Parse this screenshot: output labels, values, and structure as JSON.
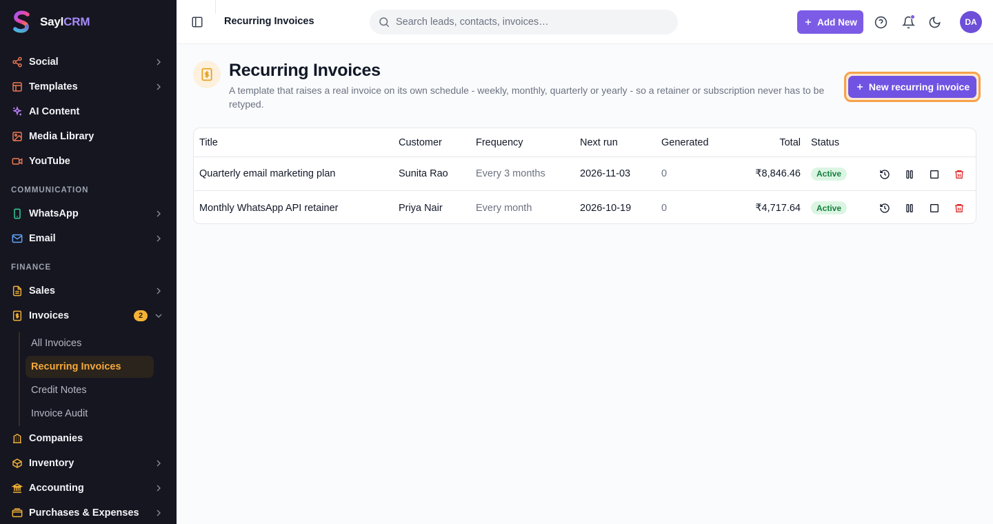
{
  "brand": {
    "name_prefix": "Sayl",
    "name_suffix": "CRM"
  },
  "sidebar": {
    "top_items": [
      {
        "label": "Social",
        "icon": "share-icon",
        "has_chevron": true
      },
      {
        "label": "Templates",
        "icon": "layout-icon",
        "has_chevron": true
      },
      {
        "label": "AI Content",
        "icon": "sparkles-icon",
        "has_chevron": false
      },
      {
        "label": "Media Library",
        "icon": "image-icon",
        "has_chevron": false
      },
      {
        "label": "YouTube",
        "icon": "video-icon",
        "has_chevron": false
      }
    ],
    "section_communication": "COMMUNICATION",
    "communication_items": [
      {
        "label": "WhatsApp",
        "icon": "phone-icon"
      },
      {
        "label": "Email",
        "icon": "mail-icon"
      }
    ],
    "section_finance": "FINANCE",
    "finance_items": [
      {
        "label": "Sales",
        "icon": "file-icon"
      },
      {
        "label": "Invoices",
        "icon": "invoice-icon",
        "badge": "2"
      }
    ],
    "invoice_sub_items": [
      {
        "label": "All Invoices",
        "active": false
      },
      {
        "label": "Recurring Invoices",
        "active": true
      },
      {
        "label": "Credit Notes",
        "active": false
      },
      {
        "label": "Invoice Audit",
        "active": false
      }
    ],
    "bottom_items": [
      {
        "label": "Companies",
        "icon": "building-icon",
        "has_chevron": false
      },
      {
        "label": "Inventory",
        "icon": "package-icon",
        "has_chevron": true
      },
      {
        "label": "Accounting",
        "icon": "landmark-icon",
        "has_chevron": true
      },
      {
        "label": "Purchases & Expenses",
        "icon": "wallet-icon",
        "has_chevron": true
      }
    ]
  },
  "topbar": {
    "breadcrumb": "Recurring Invoices",
    "search_placeholder": "Search leads, contacts, invoices…",
    "add_new_label": "Add New",
    "avatar_initials": "DA"
  },
  "page": {
    "title": "Recurring Invoices",
    "description": "A template that raises a real invoice on its own schedule - weekly, monthly, quarterly or yearly - so a retainer or subscription never has to be retyped.",
    "new_button_label": "New recurring invoice"
  },
  "table": {
    "columns": {
      "title": "Title",
      "customer": "Customer",
      "frequency": "Frequency",
      "next_run": "Next run",
      "generated": "Generated",
      "total": "Total",
      "status": "Status"
    },
    "rows": [
      {
        "title": "Quarterly email marketing plan",
        "customer": "Sunita Rao",
        "frequency": "Every 3 months",
        "next_run": "2026-11-03",
        "generated": "0",
        "total": "₹8,846.46",
        "status": "Active"
      },
      {
        "title": "Monthly WhatsApp API retainer",
        "customer": "Priya Nair",
        "frequency": "Every month",
        "next_run": "2026-10-19",
        "generated": "0",
        "total": "₹4,717.64",
        "status": "Active"
      }
    ]
  },
  "colors": {
    "sidebar_bg": "#161621",
    "accent_purple": "#7c5ce6",
    "accent_orange": "#f6a93b",
    "status_green": "#15803d",
    "danger_red": "#dc2626"
  }
}
